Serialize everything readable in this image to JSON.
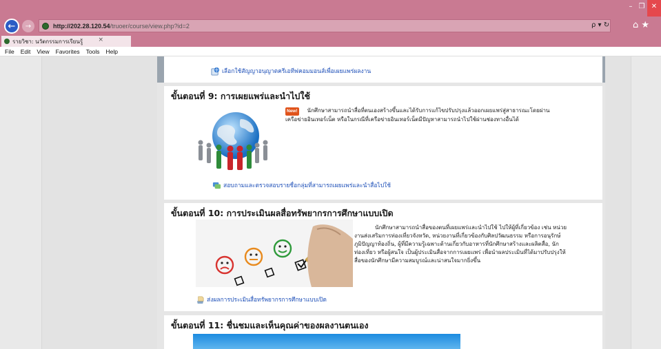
{
  "browser": {
    "url_host": "http://202.28.120.54",
    "url_path": "/truoer/course/view.php?id=2",
    "tab_title": "รายวิชา: นวัตกรรมการเรียนรู้",
    "tab_close": "×",
    "address_icons": "ρ ▾ ↻",
    "toolbar_icons": "⌂ ★",
    "window_controls": [
      "–",
      "❐",
      "✕"
    ],
    "menu": [
      "File",
      "Edit",
      "View",
      "Favorites",
      "Tools",
      "Help"
    ]
  },
  "top_link": "เลือกใช้สัญญาอนุญาตครีเอทีฟคอมมอนส์เพื่อเผยแพร่ผลงาน",
  "sections": [
    {
      "title": "ขั้นตอนที่ 9: การเผยแพร่และนำไปใช้",
      "badge": "New!",
      "text_lines": [
        "นักศึกษาสามารถนำสื่อที่ตนเองสร้างขึ้นและได้รับการแก้ไขปรับปรุงแล้วออกเผยแพร่สู่สาธารณะโดยผ่าน",
        "เครือข่ายอินเทอร์เน็ต หรือในกรณีที่เครือข่ายอินเทอร์เน็ตมีปัญหาสามารถนำไปใช้ผ่านช่องทางอื่นได้"
      ],
      "link": "สอบถามและตรวจสอบรายชื่อกลุ่มที่สามารถเผยแพร่และนำสื่อไปใช้"
    },
    {
      "title": "ขั้นตอนที่ 10: การประเมินผลสื่อทรัพยากรการศึกษาแบบเปิด",
      "text_lines": [
        "นักศึกษาสามารถนำสื่อของตนที่เผยแพร่และนำไปใช้ ไปให้ผู้ที่เกี่ยวข้อง เช่น หน่วย",
        "งานส่งเสริมการท่องเที่ยวจังหวัด, หน่วยงานที่เกี่ยวข้องกับศิลปวัฒนธรรม หรือการอนุรักษ์",
        "ภูมิปัญญาท้องถิ่น, ผู้ที่มีความรู้เฉพาะด้านเกี่ยวกับอาหารที่นักศึกษาสร้างและผลิตสื่อ, นัก",
        "ท่องเที่ยว หรือผู้สนใจ เป็นผู้ประเมินสื่อจากการเผยแพร่ เพื่อนำผลประเมินที่ได้มาปรับปรุงให้",
        "สื่อของนักศึกษามีความสมบูรณ์และน่าสนใจมากยิ่งขึ้น"
      ],
      "link": "ส่งผลการประเมินสื่อทรัพยากรการศึกษาแบบเปิด"
    },
    {
      "title": "ขั้นตอนที่ 11: ชื่นชมและเห็นคุณค่าของผลงานตนเอง"
    }
  ],
  "colors": {
    "chrome": "#c97a92",
    "link": "#1d4fb8",
    "badge": "#e0531b"
  }
}
